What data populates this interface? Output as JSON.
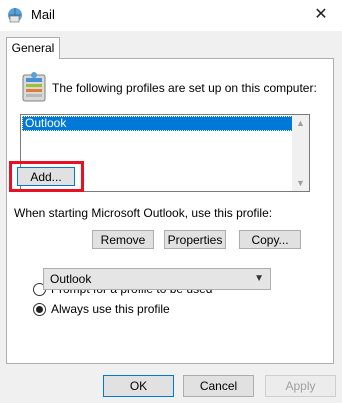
{
  "window": {
    "title": "Mail",
    "close_glyph": "✕"
  },
  "tabs": [
    {
      "label": "General"
    }
  ],
  "profiles": {
    "description": "The following profiles are set up on this computer:",
    "items": [
      "Outlook"
    ],
    "selected_index": 0
  },
  "buttons": {
    "add": "Add...",
    "remove": "Remove",
    "properties": "Properties",
    "copy": "Copy..."
  },
  "startup": {
    "label": "When starting Microsoft Outlook, use this profile:",
    "options": [
      {
        "label": "Prompt for a profile to be used",
        "checked": false
      },
      {
        "label": "Always use this profile",
        "checked": true
      }
    ],
    "profile_select": {
      "value": "Outlook"
    }
  },
  "footer": {
    "ok": "OK",
    "cancel": "Cancel",
    "apply": "Apply"
  },
  "colors": {
    "accent": "#0078d7",
    "highlight_box": "#e81123"
  },
  "icons": {
    "app": "mail-icon",
    "profiles": "mail-profiles-icon",
    "close": "close-icon",
    "dropdown": "chevron-down-icon"
  }
}
